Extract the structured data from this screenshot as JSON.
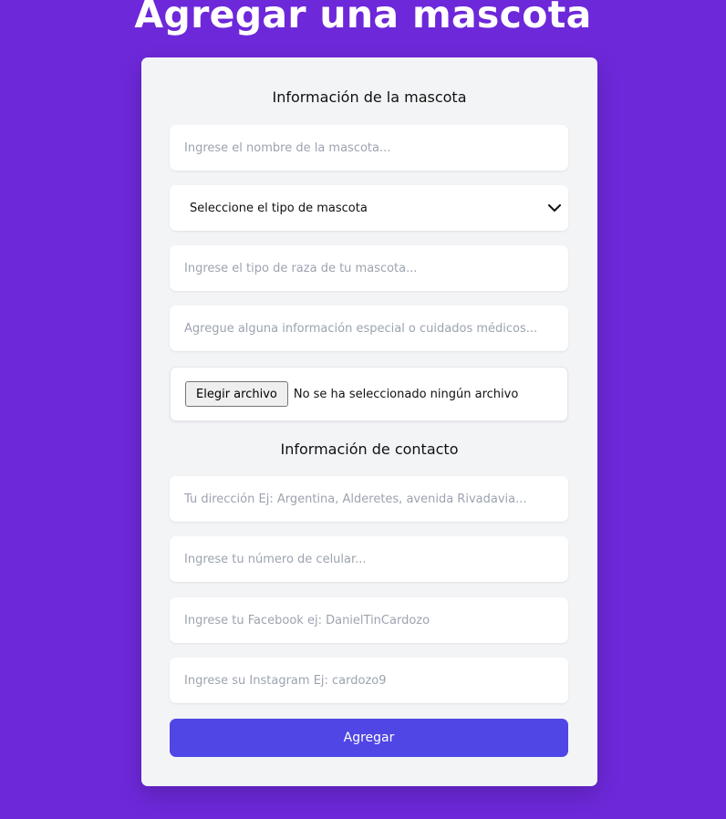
{
  "page": {
    "title": "Agregar una mascota"
  },
  "pet_section": {
    "heading": "Información de la mascota",
    "name_placeholder": "Ingrese el nombre de la mascota...",
    "type_select_value": "Seleccione el tipo de mascota",
    "breed_placeholder": "Ingrese el tipo de raza de tu mascota...",
    "info_placeholder": "Agregue alguna información especial o cuidados médicos...",
    "file_button_label": "Elegir archivo",
    "file_status": "No se ha seleccionado ningún archivo"
  },
  "contact_section": {
    "heading": "Información de contacto",
    "address_placeholder": "Tu dirección Ej: Argentina, Alderetes, avenida Rivadavia...",
    "phone_placeholder": "Ingrese tu número de celular...",
    "facebook_placeholder": "Ingrese tu Facebook ej: DanielTinCardozo",
    "instagram_placeholder": "Ingrese su Instagram Ej: cardozo9"
  },
  "actions": {
    "submit_label": "Agregar"
  },
  "colors": {
    "background": "#6d28d9",
    "card": "#f3f4f6",
    "accent": "#4f46e5"
  },
  "icons": {
    "select_chevron": "chevron-down-icon"
  }
}
